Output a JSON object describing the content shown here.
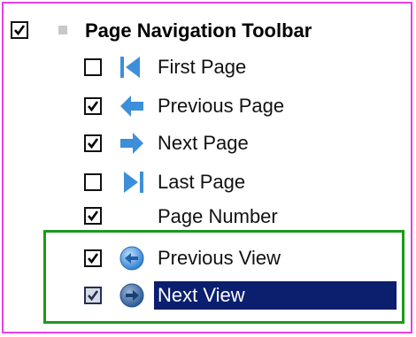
{
  "toolbar_group": {
    "label": "Page Navigation Toolbar",
    "checked": true
  },
  "items": [
    {
      "label": "First Page",
      "checked": false,
      "icon": "first-page-icon"
    },
    {
      "label": "Previous Page",
      "checked": true,
      "icon": "previous-page-arrow-icon"
    },
    {
      "label": "Next Page",
      "checked": true,
      "icon": "next-page-arrow-icon"
    },
    {
      "label": "Last Page",
      "checked": false,
      "icon": "last-page-icon"
    },
    {
      "label": "Page Number",
      "checked": true,
      "icon": ""
    },
    {
      "label": "Previous View",
      "checked": true,
      "icon": "previous-view-icon"
    },
    {
      "label": "Next View",
      "checked": true,
      "icon": "next-view-icon",
      "selected": true
    }
  ],
  "colors": {
    "frame": "#e640e6",
    "highlight_box": "#1c9a1c",
    "selection_bg": "#0b1f6e",
    "arrow_blue": "#3d8fd9"
  }
}
